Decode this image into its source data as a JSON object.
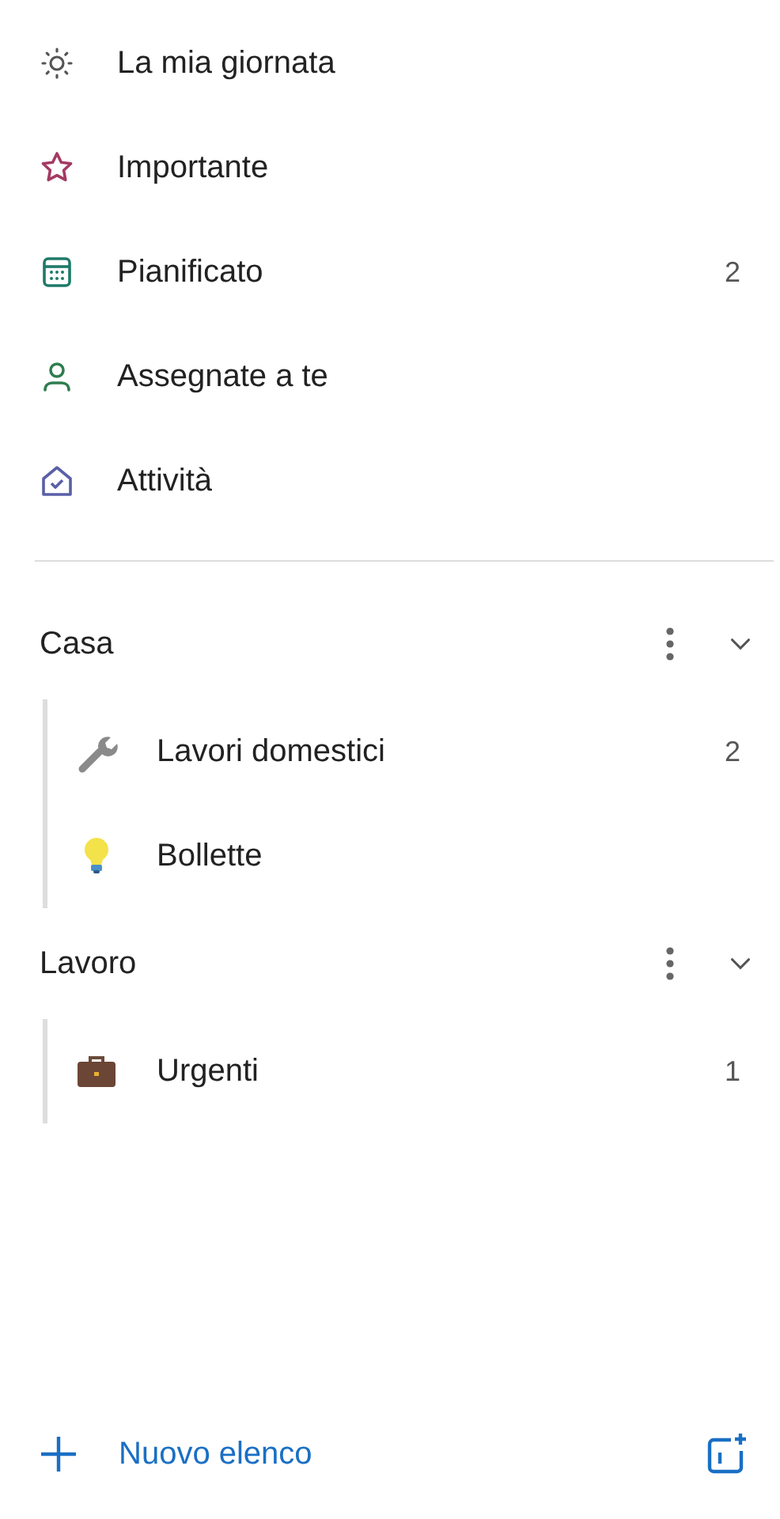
{
  "smart_lists": [
    {
      "kind": "sun",
      "label": "La mia giornata"
    },
    {
      "kind": "star",
      "label": "Importante"
    },
    {
      "kind": "calendar",
      "label": "Pianificato",
      "count": "2"
    },
    {
      "kind": "person",
      "label": "Assegnate a te"
    },
    {
      "kind": "house",
      "label": "Attività"
    }
  ],
  "groups": [
    {
      "name": "Casa",
      "expanded": true,
      "lists": [
        {
          "kind": "wrench",
          "label": "Lavori domestici",
          "count": "2"
        },
        {
          "kind": "bulb",
          "label": "Bollette"
        }
      ]
    },
    {
      "name": "Lavoro",
      "expanded": true,
      "lists": [
        {
          "kind": "briefcase",
          "label": "Urgenti",
          "count": "1"
        }
      ]
    }
  ],
  "footer": {
    "new_list": "Nuovo elenco"
  }
}
